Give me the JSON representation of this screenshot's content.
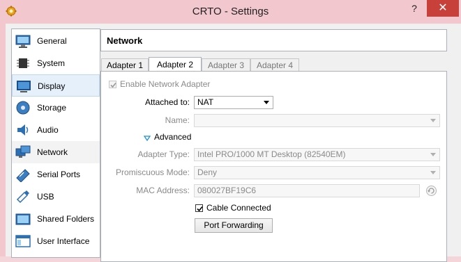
{
  "window": {
    "title": "CRTO - Settings",
    "help_label": "?",
    "close_label": "✕",
    "app_icon": "gear-icon",
    "colors": {
      "frame": "#f2c7cd",
      "close": "#c7413a",
      "selection": "#e5f0fb"
    }
  },
  "sidebar": {
    "items": [
      {
        "label": "General",
        "icon": "general-monitor-icon"
      },
      {
        "label": "System",
        "icon": "chip-icon"
      },
      {
        "label": "Display",
        "icon": "display-icon"
      },
      {
        "label": "Storage",
        "icon": "disk-icon"
      },
      {
        "label": "Audio",
        "icon": "speaker-icon"
      },
      {
        "label": "Network",
        "icon": "network-icon"
      },
      {
        "label": "Serial Ports",
        "icon": "serial-port-icon"
      },
      {
        "label": "USB",
        "icon": "usb-icon"
      },
      {
        "label": "Shared Folders",
        "icon": "folder-icon"
      },
      {
        "label": "User Interface",
        "icon": "window-icon"
      }
    ],
    "selected": "Display",
    "hovered": "Network"
  },
  "page": {
    "title": "Network"
  },
  "tabs": [
    {
      "label": "Adapter 1"
    },
    {
      "label": "Adapter 2"
    },
    {
      "label": "Adapter 3"
    },
    {
      "label": "Adapter 4"
    }
  ],
  "active_tab": "Adapter 2",
  "adapter": {
    "enable_label": "Enable Network Adapter",
    "enable_checked": true,
    "attached_label": "Attached to:",
    "attached_value": "NAT",
    "name_label": "Name:",
    "name_value": "",
    "advanced_label": "Advanced",
    "adapter_type_label": "Adapter Type:",
    "adapter_type_value": "Intel PRO/1000 MT Desktop (82540EM)",
    "promiscuous_label": "Promiscuous Mode:",
    "promiscuous_value": "Deny",
    "mac_label": "MAC Address:",
    "mac_value": "080027BF19C6",
    "cable_label": "Cable Connected",
    "cable_checked": true,
    "port_forwarding_label": "Port Forwarding"
  }
}
